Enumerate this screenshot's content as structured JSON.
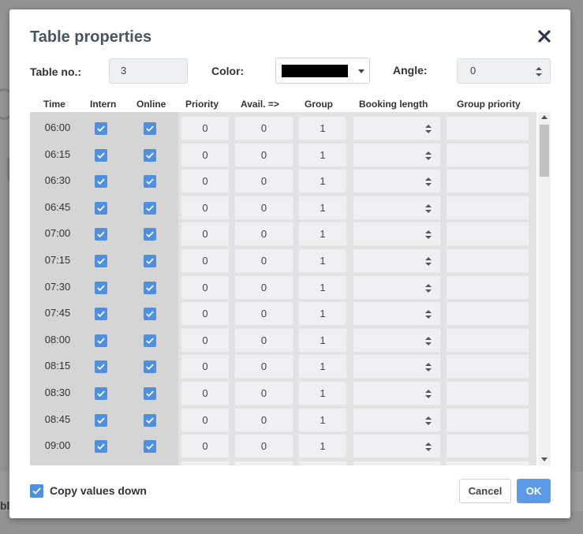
{
  "background": {
    "partial_text": "bl"
  },
  "dialog": {
    "title": "Table properties",
    "close_icon": "close-icon"
  },
  "form": {
    "table_no_label": "Table no.:",
    "table_no_value": "3",
    "color_label": "Color:",
    "color_value": "#000000",
    "angle_label": "Angle:",
    "angle_value": "0"
  },
  "table": {
    "headers": [
      "Time",
      "Intern",
      "Online",
      "Priority",
      "Avail. =>",
      "Group",
      "Booking length",
      "Group priority"
    ],
    "rows": [
      {
        "time": "06:00",
        "intern": true,
        "online": true,
        "priority": "0",
        "avail": "0",
        "group": "1",
        "booking_length": "",
        "group_priority": ""
      },
      {
        "time": "06:15",
        "intern": true,
        "online": true,
        "priority": "0",
        "avail": "0",
        "group": "1",
        "booking_length": "",
        "group_priority": ""
      },
      {
        "time": "06:30",
        "intern": true,
        "online": true,
        "priority": "0",
        "avail": "0",
        "group": "1",
        "booking_length": "",
        "group_priority": ""
      },
      {
        "time": "06:45",
        "intern": true,
        "online": true,
        "priority": "0",
        "avail": "0",
        "group": "1",
        "booking_length": "",
        "group_priority": ""
      },
      {
        "time": "07:00",
        "intern": true,
        "online": true,
        "priority": "0",
        "avail": "0",
        "group": "1",
        "booking_length": "",
        "group_priority": ""
      },
      {
        "time": "07:15",
        "intern": true,
        "online": true,
        "priority": "0",
        "avail": "0",
        "group": "1",
        "booking_length": "",
        "group_priority": ""
      },
      {
        "time": "07:30",
        "intern": true,
        "online": true,
        "priority": "0",
        "avail": "0",
        "group": "1",
        "booking_length": "",
        "group_priority": ""
      },
      {
        "time": "07:45",
        "intern": true,
        "online": true,
        "priority": "0",
        "avail": "0",
        "group": "1",
        "booking_length": "",
        "group_priority": ""
      },
      {
        "time": "08:00",
        "intern": true,
        "online": true,
        "priority": "0",
        "avail": "0",
        "group": "1",
        "booking_length": "",
        "group_priority": ""
      },
      {
        "time": "08:15",
        "intern": true,
        "online": true,
        "priority": "0",
        "avail": "0",
        "group": "1",
        "booking_length": "",
        "group_priority": ""
      },
      {
        "time": "08:30",
        "intern": true,
        "online": true,
        "priority": "0",
        "avail": "0",
        "group": "1",
        "booking_length": "",
        "group_priority": ""
      },
      {
        "time": "08:45",
        "intern": true,
        "online": true,
        "priority": "0",
        "avail": "0",
        "group": "1",
        "booking_length": "",
        "group_priority": ""
      },
      {
        "time": "09:00",
        "intern": true,
        "online": true,
        "priority": "0",
        "avail": "0",
        "group": "1",
        "booking_length": "",
        "group_priority": ""
      }
    ]
  },
  "footer": {
    "copy_values_down_label": "Copy values down",
    "copy_values_down_checked": true,
    "cancel_label": "Cancel",
    "ok_label": "OK"
  },
  "colors": {
    "accent": "#4f8fdd",
    "ok_button": "#5b9ae6",
    "grid_background": "#d5d5d5",
    "input_background": "#eef0f3"
  }
}
